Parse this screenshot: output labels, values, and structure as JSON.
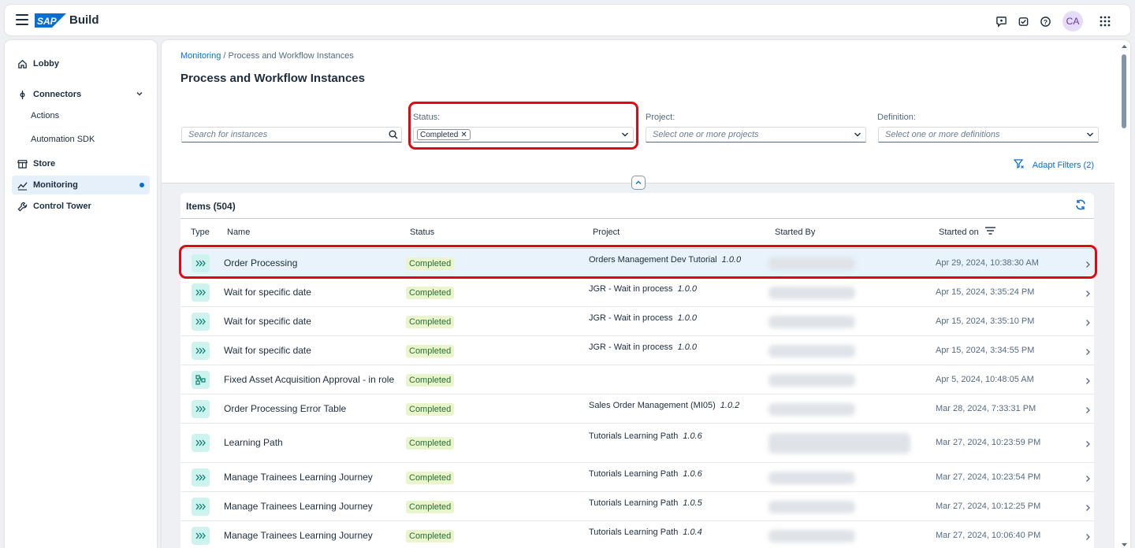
{
  "shell": {
    "logo_text": "SAP",
    "app_name": "Build",
    "avatar_initials": "CA",
    "icons": [
      "feedback-icon",
      "joule-icon",
      "help-icon",
      "product-switch-icon"
    ]
  },
  "sidebar": {
    "items": [
      {
        "label": "Lobby",
        "icon": "home-icon"
      },
      {
        "label": "Connectors",
        "icon": "connector-icon"
      },
      {
        "label": "Actions"
      },
      {
        "label": "Automation SDK"
      },
      {
        "label": "Store",
        "icon": "store-icon"
      },
      {
        "label": "Monitoring",
        "icon": "monitoring-icon"
      },
      {
        "label": "Control Tower",
        "icon": "wrench-icon"
      }
    ]
  },
  "page": {
    "breadcrumb_link": "Monitoring",
    "breadcrumb_current": " / Process and Workflow Instances",
    "title": "Process and Workflow Instances"
  },
  "filters": {
    "search_placeholder": "Search for instances",
    "status_label": "Status:",
    "status_token": "Completed",
    "project_label": "Project:",
    "project_placeholder": "Select one or more projects",
    "definition_label": "Definition:",
    "definition_placeholder": "Select one or more definitions",
    "adapt_label": "Adapt Filters (2)"
  },
  "table": {
    "title": "Items (504)",
    "columns": {
      "type": "Type",
      "name": "Name",
      "status": "Status",
      "project": "Project",
      "started_by": "Started By",
      "started_on": "Started on"
    },
    "rows": [
      {
        "name": "Order Processing",
        "status": "Completed",
        "project": "Orders Management Dev Tutorial",
        "version": "1.0.0",
        "date": "Apr 29, 2024, 10:38:30 AM",
        "type": "process"
      },
      {
        "name": "Wait for specific date",
        "status": "Completed",
        "project": "JGR - Wait in process",
        "version": "1.0.0",
        "date": "Apr 15, 2024, 3:35:24 PM",
        "type": "process"
      },
      {
        "name": "Wait for specific date",
        "status": "Completed",
        "project": "JGR - Wait in process",
        "version": "1.0.0",
        "date": "Apr 15, 2024, 3:35:10 PM",
        "type": "process"
      },
      {
        "name": "Wait for specific date",
        "status": "Completed",
        "project": "JGR - Wait in process",
        "version": "1.0.0",
        "date": "Apr 15, 2024, 3:34:55 PM",
        "type": "process"
      },
      {
        "name": "Fixed Asset Acquisition Approval - in role",
        "status": "Completed",
        "project": "",
        "version": "",
        "date": "Apr 5, 2024, 10:48:05 AM",
        "type": "workflow"
      },
      {
        "name": "Order Processing Error Table",
        "status": "Completed",
        "project": "Sales Order Management (MI05)",
        "version": "1.0.2",
        "date": "Mar 28, 2024, 7:33:31 PM",
        "type": "process"
      },
      {
        "name": "Learning Path",
        "status": "Completed",
        "project": "Tutorials Learning Path",
        "version": "1.0.6",
        "date": "Mar 27, 2024, 10:23:59 PM",
        "type": "process"
      },
      {
        "name": "Manage Trainees Learning Journey",
        "status": "Completed",
        "project": "Tutorials Learning Path",
        "version": "1.0.6",
        "date": "Mar 27, 2024, 10:23:54 PM",
        "type": "process"
      },
      {
        "name": "Manage Trainees Learning Journey",
        "status": "Completed",
        "project": "Tutorials Learning Path",
        "version": "1.0.5",
        "date": "Mar 27, 2024, 10:12:25 PM",
        "type": "process"
      },
      {
        "name": "Manage Trainees Learning Journey",
        "status": "Completed",
        "project": "Tutorials Learning Path",
        "version": "1.0.4",
        "date": "Mar 27, 2024, 10:06:40 PM",
        "type": "process"
      }
    ]
  },
  "colors": {
    "accent": "#0a6ed1",
    "highlight": "#e30613",
    "status_bg": "#ebf5cb",
    "status_text": "#256f3a",
    "type_icon_bg": "#cdf3ee"
  }
}
